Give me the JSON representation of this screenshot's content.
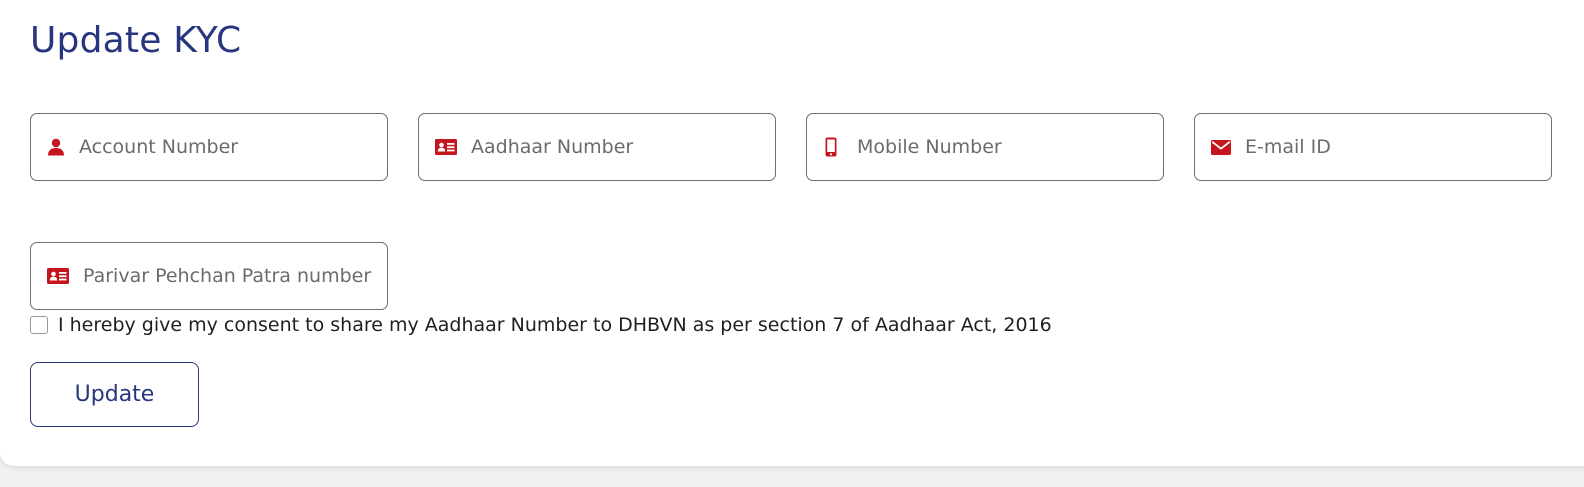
{
  "page": {
    "title": "Update KYC"
  },
  "fields": {
    "account": {
      "placeholder": "Account Number",
      "value": "",
      "icon": "user-icon"
    },
    "aadhaar": {
      "placeholder": "Aadhaar Number",
      "value": "",
      "icon": "id-card-icon"
    },
    "mobile": {
      "placeholder": "Mobile Number",
      "value": "",
      "icon": "mobile-phone-icon"
    },
    "email": {
      "placeholder": "E-mail ID",
      "value": "",
      "icon": "envelope-icon"
    },
    "ppp": {
      "placeholder": "Parivar Pehchan Patra number",
      "value": "",
      "icon": "id-card-icon"
    }
  },
  "consent": {
    "checked": false,
    "label": "I hereby give my consent to share my Aadhaar Number to DHBVN as per section 7 of Aadhaar Act, 2016"
  },
  "actions": {
    "update_label": "Update"
  },
  "colors": {
    "title": "#27367f",
    "icon": "#c4161c",
    "border": "#6c6f7a",
    "button": "#27367f"
  }
}
